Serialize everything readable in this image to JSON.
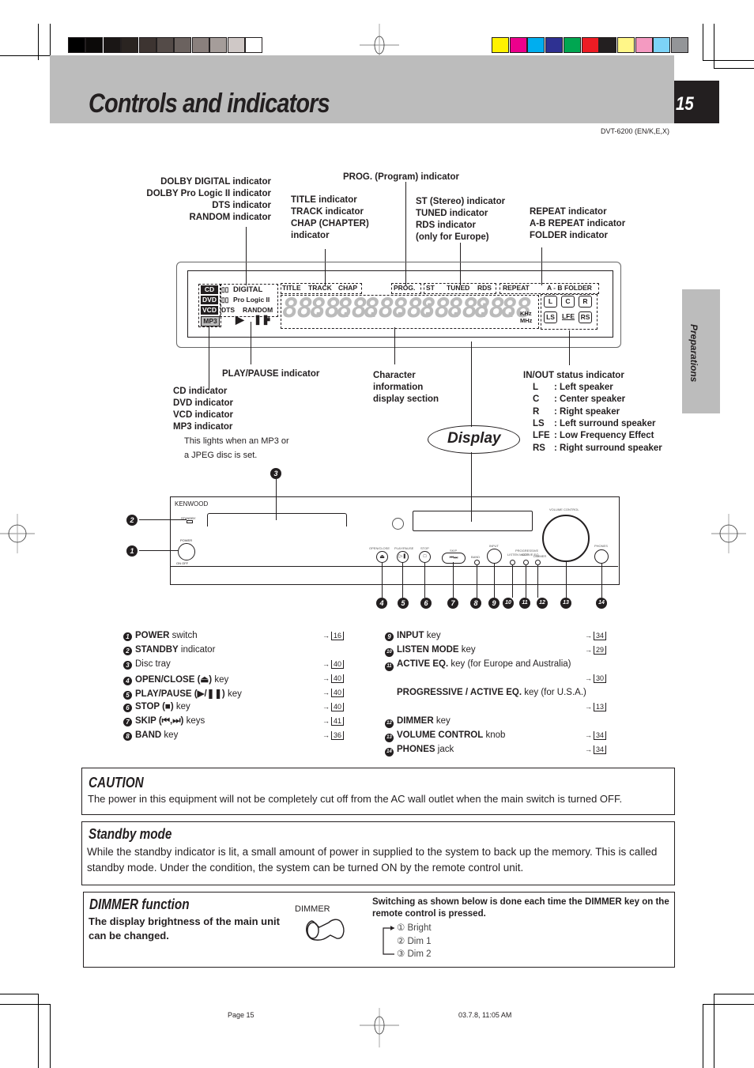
{
  "header": {
    "title": "Controls and indicators",
    "page_number": "15",
    "model": "DVT-6200 (EN/K,E,X)",
    "side_tab": "Preparations",
    "gray_swatches": [
      "#000000",
      "#0c0a09",
      "#1a1615",
      "#2a2421",
      "#3d3431",
      "#544b48",
      "#6b625f",
      "#8a807d",
      "#a59d9a",
      "#cfc8c6",
      "#ffffff"
    ],
    "color_swatches": [
      "#fff200",
      "#ec008c",
      "#00aeef",
      "#2e3192",
      "#00a651",
      "#ed1c24",
      "#231f20",
      "#fff688",
      "#f49ac1",
      "#7dd3f7",
      "#939598"
    ]
  },
  "display_labels": {
    "dolby": [
      "DOLBY DIGITAL indicator",
      "DOLBY Pro Logic II indicator",
      "DTS indicator",
      "RANDOM indicator"
    ],
    "prog": "PROG. (Program) indicator",
    "title_track": [
      "TITLE indicator",
      "TRACK indicator",
      "CHAP (CHAPTER)",
      "indicator"
    ],
    "st_tuned": [
      "ST (Stereo) indicator",
      "TUNED indicator",
      "RDS indicator",
      "(only for Europe)"
    ],
    "repeat": [
      "REPEAT indicator",
      "A-B REPEAT indicator",
      "FOLDER indicator"
    ],
    "play_pause": "PLAY/PAUSE indicator",
    "disc_types": [
      "CD indicator",
      "DVD indicator",
      "VCD indicator",
      "MP3 indicator"
    ],
    "mp3_note": [
      "This lights when an MP3 or",
      "a JPEG disc is set."
    ],
    "character": [
      "Character",
      "information",
      "display section"
    ],
    "inout_title": "IN/OUT status indicator",
    "inout": [
      {
        "code": "L",
        "desc": ": Left speaker"
      },
      {
        "code": "C",
        "desc": ": Center speaker"
      },
      {
        "code": "R",
        "desc": ": Right speaker"
      },
      {
        "code": "LS",
        "desc": ": Left surround speaker"
      },
      {
        "code": "LFE",
        "desc": ": Low Frequency Effect"
      },
      {
        "code": "RS",
        "desc": ": Right surround speaker"
      }
    ],
    "display_callout": "Display"
  },
  "display_panel": {
    "disc": [
      "CD",
      "DVD",
      "VCD",
      "MP3"
    ],
    "dolby_digital": "DIGITAL",
    "pro_logic": "Pro Logic II",
    "dts": "DTS",
    "random": "RANDOM",
    "title": "TITLE",
    "track": "TRACK",
    "chap": "CHAP",
    "prog": "PROG.",
    "st": "ST",
    "tuned": "TUNED",
    "rds": "RDS",
    "repeat": "REPEAT",
    "ab": "A - B",
    "folder": "FOLDER",
    "khz": "KHz",
    "mhz": "MHz",
    "speakers_top": [
      "L",
      "C",
      "R"
    ],
    "speakers_bottom": [
      "LS",
      "LFE",
      "RS"
    ],
    "segments": [
      "88.",
      "88.",
      "88.",
      "88.",
      "88:",
      "88.",
      "88:",
      "88.",
      "88"
    ]
  },
  "unit": {
    "brand": "KENWOOD",
    "standby": "STANDBY",
    "power": "POWER",
    "power_sub": "ON  OFF",
    "open_close": "OPEN/CLOSE",
    "play_pause": "PLAY/PAUSE",
    "stop": "STOP",
    "skip": "SKIP",
    "band": "BAND",
    "input": "INPUT",
    "listen_mode": "LISTEN MODE",
    "active_eq": "ACTIVE EQ.",
    "progressive": "PROGRESSIVE",
    "dimmer": "DIMMER",
    "volume": "VOLUME CONTROL",
    "phones": "PHONES",
    "callouts": [
      "1",
      "2",
      "3",
      "4",
      "5",
      "6",
      "7",
      "8",
      "9",
      "10",
      "11",
      "12",
      "13",
      "14"
    ]
  },
  "parts_left": [
    {
      "num": "1",
      "bold": "POWER",
      "rest": " switch",
      "page": "16"
    },
    {
      "num": "2",
      "bold": "STANDBY",
      "rest": " indicator",
      "page": ""
    },
    {
      "num": "3",
      "bold": "",
      "rest": "Disc tray",
      "page": "40"
    },
    {
      "num": "4",
      "bold": "OPEN/CLOSE (⏏)",
      "rest": " key",
      "page": "40"
    },
    {
      "num": "5",
      "bold": "PLAY/PAUSE (▶/❚❚)",
      "rest": " key",
      "page": "40"
    },
    {
      "num": "6",
      "bold": "STOP (■)",
      "rest": " key",
      "page": "40"
    },
    {
      "num": "7",
      "bold": "SKIP (⏮,⏭)",
      "rest": " keys",
      "page": "41"
    },
    {
      "num": "8",
      "bold": "BAND",
      "rest": " key",
      "page": "36"
    }
  ],
  "parts_right": [
    {
      "num": "9",
      "bold": "INPUT",
      "rest": " key",
      "page": "34"
    },
    {
      "num": "10",
      "bold": "LISTEN MODE",
      "rest": " key",
      "page": "29"
    },
    {
      "num": "11",
      "bold": "ACTIVE EQ.",
      "rest": " key (for Europe and Australia)",
      "page": "30"
    },
    {
      "num": "",
      "bold": "PROGRESSIVE / ACTIVE EQ.",
      "rest": " key  (for U.S.A.)",
      "page": "13"
    },
    {
      "num": "12",
      "bold": "DIMMER",
      "rest": " key",
      "page": ""
    },
    {
      "num": "13",
      "bold": "VOLUME CONTROL",
      "rest": " knob",
      "page": "34"
    },
    {
      "num": "14",
      "bold": "PHONES",
      "rest": " jack",
      "page": "34"
    }
  ],
  "caution": {
    "title": "CAUTION",
    "text": "The power in this equipment will not be completely cut off from the AC wall outlet when the main switch is turned OFF."
  },
  "standby": {
    "title": "Standby mode",
    "text": "While the standby indicator is lit, a small amount of power in supplied to the system to back up the memory. This is called standby mode. Under the condition, the system can be turned ON by the remote control unit."
  },
  "dimmer": {
    "title": "DIMMER function",
    "desc": "The display brightness of the main unit can be changed.",
    "key_label": "DIMMER",
    "switching": "Switching as shown below is done each time the DIMMER key on the remote control is pressed.",
    "steps": [
      "① Bright",
      "② Dim 1",
      "③ Dim 2"
    ]
  },
  "footer": {
    "page": "Page 15",
    "timestamp": "03.7.8, 11:05 AM"
  }
}
